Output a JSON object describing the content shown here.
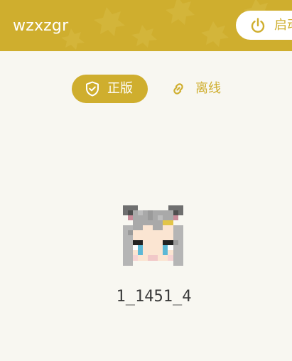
{
  "header": {
    "username": "wzxzgr",
    "launch_label": "启动",
    "accent_color": "#cfae2e"
  },
  "mode_tabs": [
    {
      "label": "正版",
      "icon": "shield-check-icon",
      "selected": true
    },
    {
      "label": "离线",
      "icon": "link-icon",
      "selected": false
    }
  ],
  "account": {
    "avatar_icon": "minecraft-skin-head-icon",
    "profile_name": "1_1451_4"
  }
}
